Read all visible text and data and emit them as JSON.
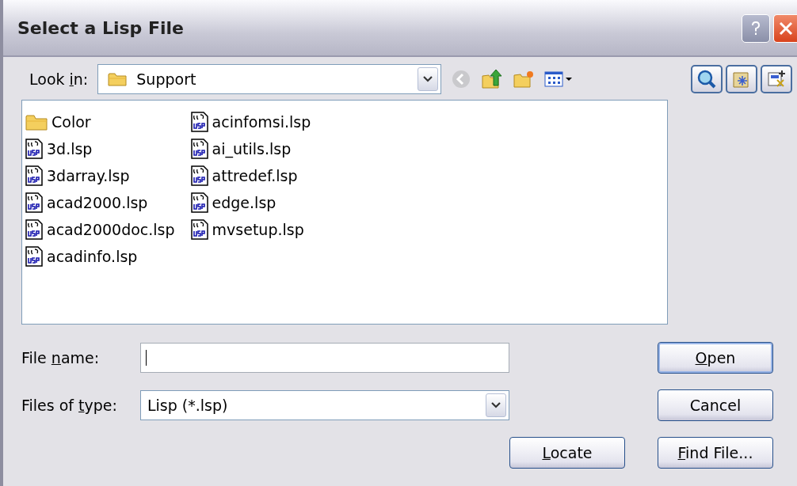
{
  "window": {
    "title": "Select a Lisp File"
  },
  "look_in": {
    "label": [
      {
        "text": "Look ",
        "underline": false
      },
      {
        "text": "i",
        "underline": true
      },
      {
        "text": "n:",
        "underline": false
      }
    ],
    "value": "Support"
  },
  "files": [
    {
      "name": "Color",
      "kind": "folder"
    },
    {
      "name": "3d.lsp",
      "kind": "lisp"
    },
    {
      "name": "3darray.lsp",
      "kind": "lisp"
    },
    {
      "name": "acad2000.lsp",
      "kind": "lisp"
    },
    {
      "name": "acad2000doc.lsp",
      "kind": "lisp"
    },
    {
      "name": "acadinfo.lsp",
      "kind": "lisp"
    },
    {
      "name": "acinfomsi.lsp",
      "kind": "lisp"
    },
    {
      "name": "ai_utils.lsp",
      "kind": "lisp"
    },
    {
      "name": "attredef.lsp",
      "kind": "lisp"
    },
    {
      "name": "edge.lsp",
      "kind": "lisp"
    },
    {
      "name": "mvsetup.lsp",
      "kind": "lisp"
    }
  ],
  "file_name": {
    "label": [
      {
        "text": "File ",
        "underline": false
      },
      {
        "text": "n",
        "underline": true
      },
      {
        "text": "ame:",
        "underline": false
      }
    ]
  },
  "file_type": {
    "label": [
      {
        "text": "Files of ",
        "underline": false
      },
      {
        "text": "t",
        "underline": true
      },
      {
        "text": "ype:",
        "underline": false
      }
    ],
    "value": "Lisp (*.lsp)"
  },
  "buttons": {
    "open": [
      {
        "text": "O",
        "underline": true
      },
      {
        "text": "pen",
        "underline": false
      }
    ],
    "cancel": [
      {
        "text": "Cancel",
        "underline": false
      }
    ],
    "locate": [
      {
        "text": "L",
        "underline": true
      },
      {
        "text": "ocate",
        "underline": false
      }
    ],
    "find": [
      {
        "text": "F",
        "underline": true
      },
      {
        "text": "ind File...",
        "underline": false
      }
    ]
  }
}
